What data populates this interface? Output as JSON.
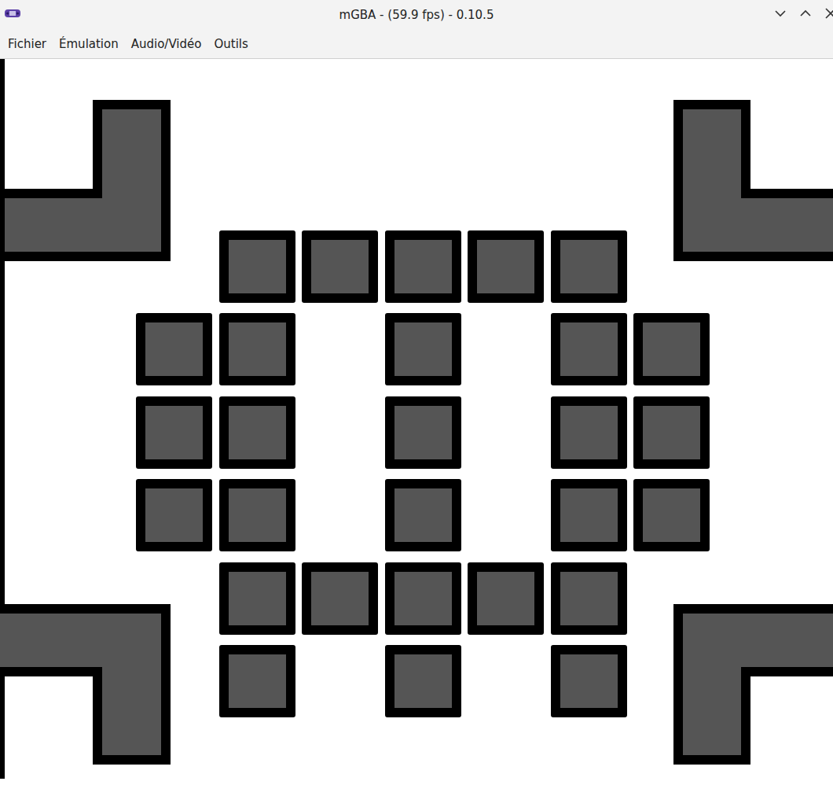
{
  "window": {
    "title": "mGBA - (59.9 fps) - 0.10.5"
  },
  "menu": [
    {
      "label": "Fichier"
    },
    {
      "label": "Émulation"
    },
    {
      "label": "Audio/Vidéo"
    },
    {
      "label": "Outils"
    }
  ],
  "playfield": {
    "rows": [
      [
        false,
        true,
        true,
        true,
        true,
        true,
        false
      ],
      [
        true,
        true,
        false,
        true,
        false,
        true,
        true
      ],
      [
        true,
        true,
        false,
        true,
        false,
        true,
        true
      ],
      [
        true,
        true,
        false,
        true,
        false,
        true,
        true
      ],
      [
        false,
        true,
        true,
        true,
        true,
        true,
        false
      ],
      [
        false,
        true,
        false,
        true,
        false,
        true,
        false
      ]
    ]
  }
}
